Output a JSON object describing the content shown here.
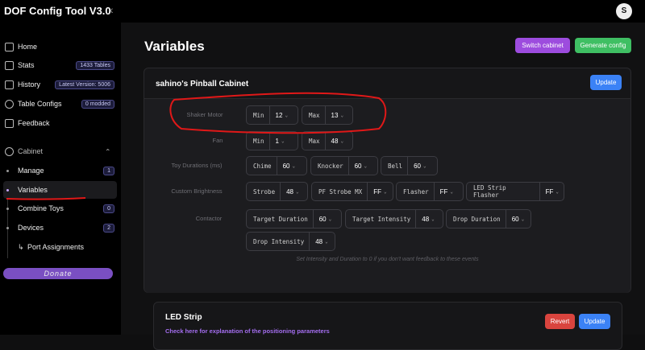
{
  "app": {
    "title": "DOF Config Tool V3.0",
    "collapse_glyph": "‹",
    "avatar_letter": "S"
  },
  "sidebar": {
    "items": [
      {
        "label": "Home",
        "icon": "home-icon"
      },
      {
        "label": "Stats",
        "icon": "table-icon",
        "badge": "1433 Tables"
      },
      {
        "label": "History",
        "icon": "history-icon",
        "badge": "Latest Version: 5006"
      },
      {
        "label": "Table Configs",
        "icon": "gear-icon",
        "badge": "0 modded"
      },
      {
        "label": "Feedback",
        "icon": "document-icon"
      }
    ],
    "cabinet_label": "Cabinet",
    "sub_items": [
      {
        "label": "Manage",
        "badge": "1"
      },
      {
        "label": "Variables"
      },
      {
        "label": "Combine Toys",
        "badge": "0"
      },
      {
        "label": "Devices",
        "badge": "2"
      }
    ],
    "port_assignments": "Port Assignments",
    "port_glyph": "↳",
    "donate": "Donate"
  },
  "main": {
    "title": "Variables",
    "switch_cabinet": "Switch cabinet",
    "generate_config": "Generate config",
    "colors": {
      "purple": "#9d4cde",
      "green": "#3fbf63",
      "blue": "#3b82f6",
      "red": "#d9443e"
    }
  },
  "cabinet_card": {
    "title": "sahino's Pinball Cabinet",
    "update": "Update",
    "rows": {
      "shaker": {
        "label": "Shaker Motor",
        "min_key": "Min",
        "min": "12",
        "max_key": "Max",
        "max": "13"
      },
      "fan": {
        "label": "Fan",
        "min_key": "Min",
        "min": "1",
        "max_key": "Max",
        "max": "48"
      },
      "toy": {
        "label": "Toy Durations (ms)",
        "chime_key": "Chime",
        "chime": "60",
        "knocker_key": "Knocker",
        "knocker": "60",
        "bell_key": "Bell",
        "bell": "60"
      },
      "brightness": {
        "label": "Custom Brightness",
        "strobe_key": "Strobe",
        "strobe": "48",
        "pfstrobe_key": "PF Strobe MX",
        "pfstrobe": "FF",
        "flasher_key": "Flasher",
        "flasher": "FF",
        "ledstrobe_key": "LED Strip Flasher",
        "ledstrobe": "FF"
      },
      "contactor": {
        "label": "Contactor",
        "td_key": "Target Duration",
        "td": "60",
        "ti_key": "Target Intensity",
        "ti": "48",
        "dd_key": "Drop Duration",
        "dd": "60",
        "di_key": "Drop Intensity",
        "di": "48"
      }
    },
    "hint": "Set Intensity and Duration to 0 if you don't want feedback to these events",
    "chevron": "⌄"
  },
  "led_card": {
    "title": "LED Strip",
    "link": "Check here for explanation of the positioning parameters",
    "revert": "Revert",
    "update": "Update"
  }
}
